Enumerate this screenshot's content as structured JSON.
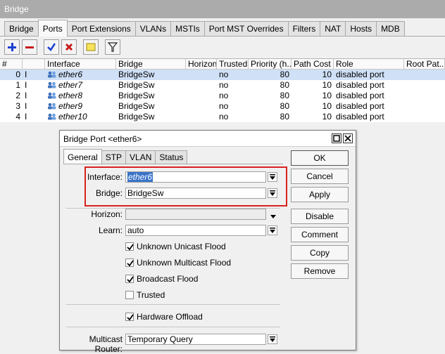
{
  "window": {
    "title": "Bridge"
  },
  "tabs": [
    "Bridge",
    "Ports",
    "Port Extensions",
    "VLANs",
    "MSTIs",
    "Port MST Overrides",
    "Filters",
    "NAT",
    "Hosts",
    "MDB"
  ],
  "active_tab": "Ports",
  "table": {
    "columns": [
      "#",
      "Interface",
      "Bridge",
      "Horizon",
      "Trusted",
      "Priority (h...",
      "Path Cost",
      "Role",
      "Root Pat..."
    ],
    "rows": [
      {
        "num": "0",
        "flag": "I",
        "interface": "ether6",
        "bridge": "BridgeSw",
        "horizon": "",
        "trusted": "no",
        "priority": "80",
        "path_cost": "10",
        "role": "disabled port"
      },
      {
        "num": "1",
        "flag": "I",
        "interface": "ether7",
        "bridge": "BridgeSw",
        "horizon": "",
        "trusted": "no",
        "priority": "80",
        "path_cost": "10",
        "role": "disabled port"
      },
      {
        "num": "2",
        "flag": "I",
        "interface": "ether8",
        "bridge": "BridgeSw",
        "horizon": "",
        "trusted": "no",
        "priority": "80",
        "path_cost": "10",
        "role": "disabled port"
      },
      {
        "num": "3",
        "flag": "I",
        "interface": "ether9",
        "bridge": "BridgeSw",
        "horizon": "",
        "trusted": "no",
        "priority": "80",
        "path_cost": "10",
        "role": "disabled port"
      },
      {
        "num": "4",
        "flag": "I",
        "interface": "ether10",
        "bridge": "BridgeSw",
        "horizon": "",
        "trusted": "no",
        "priority": "80",
        "path_cost": "10",
        "role": "disabled port"
      }
    ]
  },
  "dialog": {
    "title": "Bridge Port <ether6>",
    "tabs": [
      "General",
      "STP",
      "VLAN",
      "Status"
    ],
    "active_tab": "General",
    "fields": {
      "interface_label": "Interface:",
      "interface_value": "ether6",
      "bridge_label": "Bridge:",
      "bridge_value": "BridgeSw",
      "horizon_label": "Horizon:",
      "horizon_value": "",
      "learn_label": "Learn:",
      "learn_value": "auto",
      "multicast_router_label": "Multicast Router:",
      "multicast_router_value": "Temporary Query"
    },
    "checkboxes": [
      {
        "label": "Unknown Unicast Flood",
        "checked": true
      },
      {
        "label": "Unknown Multicast Flood",
        "checked": true
      },
      {
        "label": "Broadcast Flood",
        "checked": true
      },
      {
        "label": "Trusted",
        "checked": false
      },
      {
        "label": "Hardware Offload",
        "checked": true
      }
    ],
    "buttons": [
      "OK",
      "Cancel",
      "Apply",
      "Disable",
      "Comment",
      "Copy",
      "Remove"
    ]
  },
  "colors": {
    "selection": "#cfe0f7",
    "highlight_box": "#d9221f",
    "titlebar": "#ababab"
  }
}
